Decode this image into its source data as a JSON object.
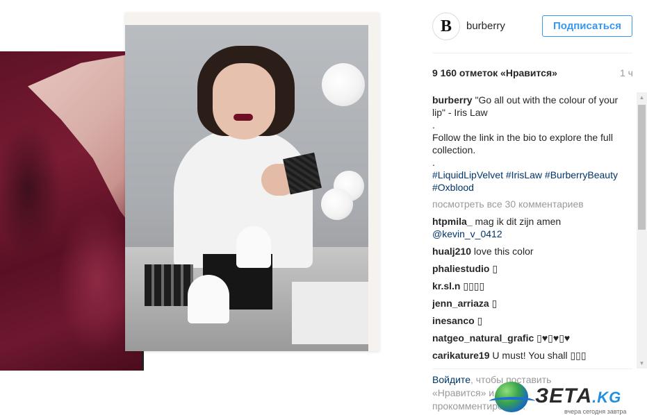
{
  "post": {
    "username": "burberry",
    "avatar_letter": "B",
    "follow_label": "Подписаться",
    "likes": "9 160 отметок «Нравится»",
    "time": "1 ч"
  },
  "caption": {
    "author": "burberry",
    "line1": "\"Go all out with the colour of your lip\" - Iris Law",
    "dot1": ".",
    "line2": "Follow the link in the bio to explore the full collection.",
    "dot2": ".",
    "hashtags": [
      "#LiquidLipVelvet",
      "#IrisLaw",
      "#BurberryBeauty",
      "#Oxblood"
    ]
  },
  "view_all_comments": "посмотреть все 30 комментариев",
  "comments": [
    {
      "user": "htpmila_",
      "text": "mag ik dit zijn amen",
      "mention": "@kevin_v_0412"
    },
    {
      "user": "hualj210",
      "text": "love this color"
    },
    {
      "user": "phaliestudio",
      "text": "▯"
    },
    {
      "user": "kr.sl.n",
      "text": "▯▯▯▯"
    },
    {
      "user": "jenn_arriaza",
      "text": "▯"
    },
    {
      "user": "inesanco",
      "text": "▯"
    },
    {
      "user": "natgeo_natural_grafic",
      "text": "▯♥▯♥▯♥"
    },
    {
      "user": "carikature19",
      "text": "U must! You shall ▯▯▯"
    }
  ],
  "login_prompt": {
    "link": "Войдите",
    "text_after_link": ", чтобы поставить «Нравится» и прокомментировать."
  },
  "watermark": {
    "brand": "ЗЕТА",
    "tld": ".KG",
    "tagline": "вчера сегодня завтра"
  }
}
